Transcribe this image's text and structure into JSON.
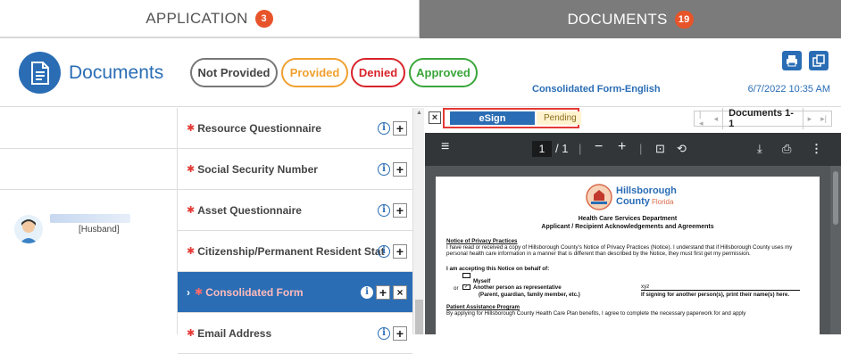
{
  "tabs": {
    "application": {
      "label": "APPLICATION",
      "count": "3"
    },
    "documents": {
      "label": "DOCUMENTS",
      "count": "19"
    }
  },
  "header": {
    "title": "Documents",
    "filters": {
      "not_provided": "Not Provided",
      "provided": "Provided",
      "denied": "Denied",
      "approved": "Approved"
    },
    "form_name": "Consolidated Form-English",
    "date": "6/7/2022 10:35 AM"
  },
  "members": [
    {
      "relation": "[Husband]"
    }
  ],
  "documents": [
    {
      "name": "Resource Questionnaire"
    },
    {
      "name": "Social Security Number"
    },
    {
      "name": "Asset Questionnaire"
    },
    {
      "name": "Citizenship/Permanent Resident Stat"
    },
    {
      "name": "Consolidated Form"
    },
    {
      "name": "Email Address"
    }
  ],
  "viewer": {
    "esign_label": "eSign",
    "status": "Pending",
    "pager_label": "Documents 1-1",
    "pdf": {
      "page_current": "1",
      "page_total": "/ 1",
      "logo_line1": "Hillsborough",
      "logo_line2": "County",
      "logo_line3": "Florida",
      "dept": "Health Care Services Department",
      "subtitle": "Applicant / Recipient Acknowledgements and Agreements",
      "section1_title": "Notice of Privacy Practices",
      "section1_body": "I have read or received a copy of Hillsborough County's Notice of Privacy Practices (Notice). I understand that if Hillsborough County uses my personal health care information in a manner that is different than described by the Notice, they must first get my permission.",
      "accept_label": "I am accepting this Notice on behalf of:",
      "opt_myself": "Myself",
      "opt_or": "or",
      "opt_rep": "Another person as representative",
      "opt_rep_note": "(Parent, guardian, family member, etc.)",
      "rep_name": "xyz",
      "rep_note": "If signing for another person(s), print their name(s) here.",
      "section2_title": "Patient Assistance Program",
      "section2_body": "By applying for Hillsborough County Health Care Plan benefits, I agree to complete the necessary paperwork for and apply"
    }
  },
  "colors": {
    "accent": "#2a6db5",
    "badge": "#e8542a",
    "provided": "#f0a030",
    "denied": "#d8232a",
    "approved": "#3aa63a"
  }
}
